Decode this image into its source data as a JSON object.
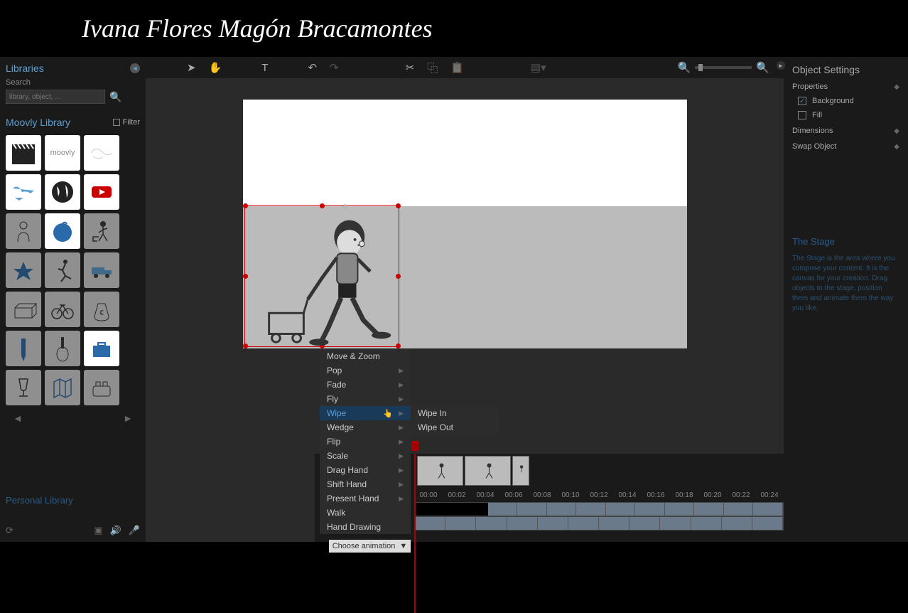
{
  "header": {
    "title": "Ivana Flores Magón Bracamontes"
  },
  "sidebar": {
    "title": "Libraries",
    "search_label": "Search",
    "search_placeholder": "library, object, ...",
    "library_name": "Moovly Library",
    "filter_label": "Filter",
    "personal": "Personal Library"
  },
  "context_menu": {
    "items": [
      {
        "label": "Move & Zoom",
        "arrow": false
      },
      {
        "label": "Pop",
        "arrow": true
      },
      {
        "label": "Fade",
        "arrow": true
      },
      {
        "label": "Fly",
        "arrow": true
      },
      {
        "label": "Wipe",
        "arrow": true,
        "hover": true
      },
      {
        "label": "Wedge",
        "arrow": true
      },
      {
        "label": "Flip",
        "arrow": true
      },
      {
        "label": "Scale",
        "arrow": true
      },
      {
        "label": "Drag Hand",
        "arrow": true
      },
      {
        "label": "Shift Hand",
        "arrow": true
      },
      {
        "label": "Present Hand",
        "arrow": true
      },
      {
        "label": "Walk",
        "arrow": false
      },
      {
        "label": "Hand Drawing",
        "arrow": false
      }
    ],
    "submenu": [
      {
        "label": "Wipe In"
      },
      {
        "label": "Wipe Out"
      }
    ]
  },
  "timeline": {
    "choose_label": "Choose animation",
    "ticks": [
      "00:00",
      "00:02",
      "00:04",
      "00:06",
      "00:08",
      "00:10",
      "00:12",
      "00:14",
      "00:16",
      "00:18",
      "00:20",
      "00:22",
      "00:24"
    ]
  },
  "right_panel": {
    "title": "Object Settings",
    "properties": "Properties",
    "background": "Background",
    "fill": "Fill",
    "dimensions": "Dimensions",
    "swap": "Swap Object",
    "help_title": "The Stage",
    "help_text": "The Stage is the area where you compose your content. It is the canvas for your creation. Drag objects to the stage, position them and animate them the way you like."
  }
}
